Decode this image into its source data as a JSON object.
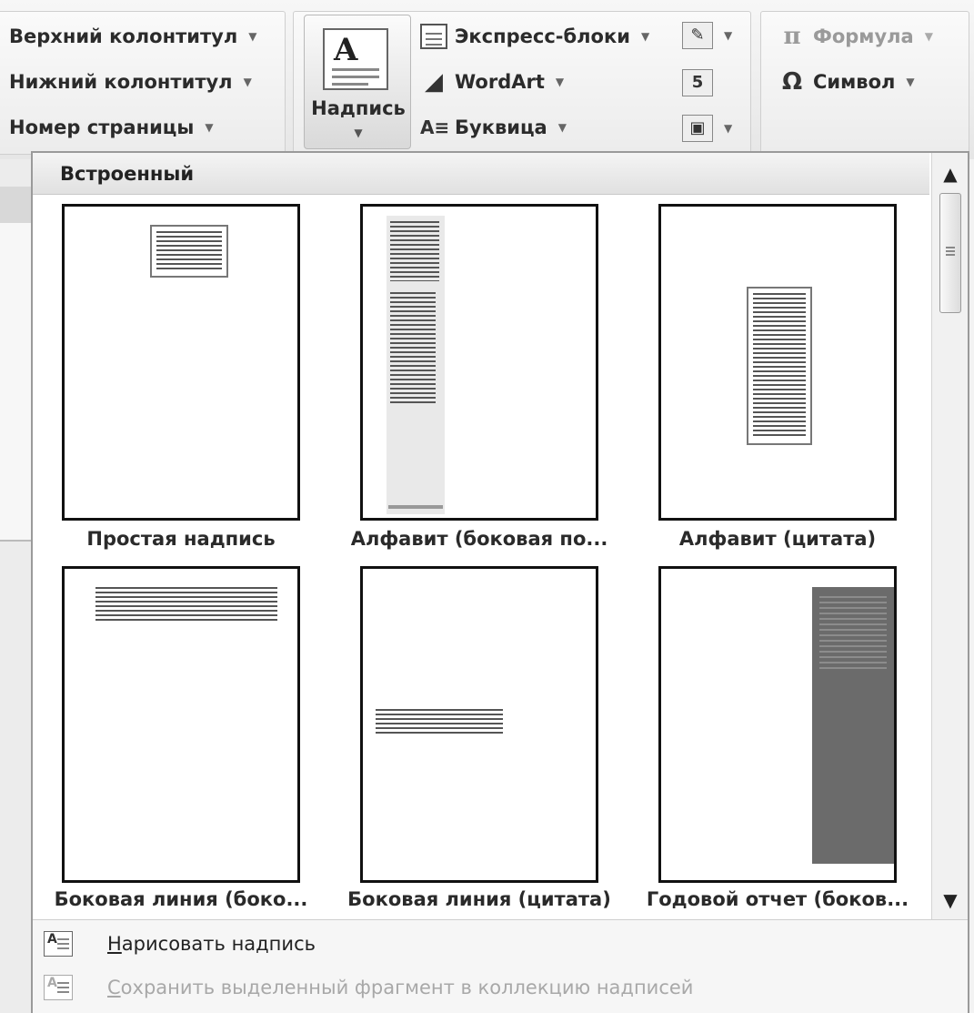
{
  "ribbon": {
    "header_footer": {
      "header": "Верхний колонтитул",
      "footer": "Нижний колонтитул",
      "page_number": "Номер страницы"
    },
    "text": {
      "textbox": "Надпись",
      "textbox_icon_letter": "A",
      "quick_parts": "Экспресс-блоки",
      "wordart": "WordArt",
      "dropcap": "Буквица"
    },
    "symbols": {
      "equation": "Формула",
      "symbol": "Символ",
      "equation_glyph": "π",
      "symbol_glyph": "Ω"
    }
  },
  "gallery": {
    "section_title": "Встроенный",
    "items": [
      {
        "caption": "Простая надпись"
      },
      {
        "caption": "Алфавит (боковая по..."
      },
      {
        "caption": "Алфавит (цитата)"
      },
      {
        "caption": "Боковая линия (боко..."
      },
      {
        "caption": "Боковая линия (цитата)"
      },
      {
        "caption": "Годовой отчет (боков..."
      }
    ]
  },
  "footer_menu": {
    "draw_textbox_first": "Н",
    "draw_textbox_rest": "арисовать надпись",
    "save_selection_first": "С",
    "save_selection_rest": "охранить выделенный фрагмент в коллекцию надписей"
  }
}
